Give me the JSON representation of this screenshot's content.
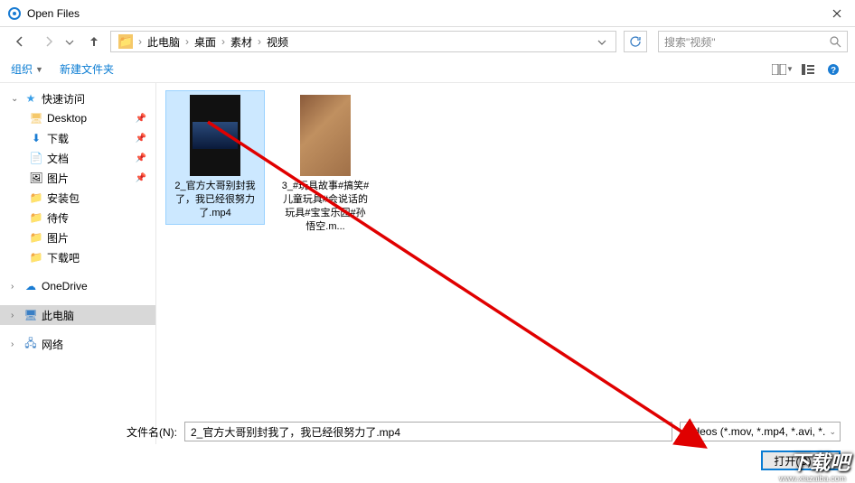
{
  "window": {
    "title": "Open Files"
  },
  "nav": {
    "path_segments": [
      "此电脑",
      "桌面",
      "素材",
      "视频"
    ],
    "search_placeholder": "搜索\"视频\""
  },
  "toolbar": {
    "organize": "组织",
    "newfolder": "新建文件夹"
  },
  "sidebar": {
    "quickaccess": "快速访问",
    "items": [
      {
        "label": "Desktop",
        "pinned": true
      },
      {
        "label": "下载",
        "pinned": true
      },
      {
        "label": "文档",
        "pinned": true
      },
      {
        "label": "图片",
        "pinned": true
      },
      {
        "label": "安装包",
        "pinned": false
      },
      {
        "label": "待传",
        "pinned": false
      },
      {
        "label": "图片",
        "pinned": false
      },
      {
        "label": "下载吧",
        "pinned": false
      }
    ],
    "onedrive": "OneDrive",
    "thispc": "此电脑",
    "network": "网络"
  },
  "files": [
    {
      "name": "2_官方大哥别封我了，我已经很努力了.mp4",
      "selected": true
    },
    {
      "name": "3_#玩具故事#搞笑#儿童玩具#会说话的玩具#宝宝乐园#孙悟空.m...",
      "selected": false
    }
  ],
  "bottom": {
    "filename_label": "文件名(N):",
    "filename_value": "2_官方大哥别封我了，我已经很努力了.mp4",
    "filetype": "Videos (*.mov, *.mp4, *.avi, *.",
    "open": "打开(O)"
  },
  "watermark": {
    "main": "下载吧",
    "sub": "www.xiazaiba.com"
  }
}
